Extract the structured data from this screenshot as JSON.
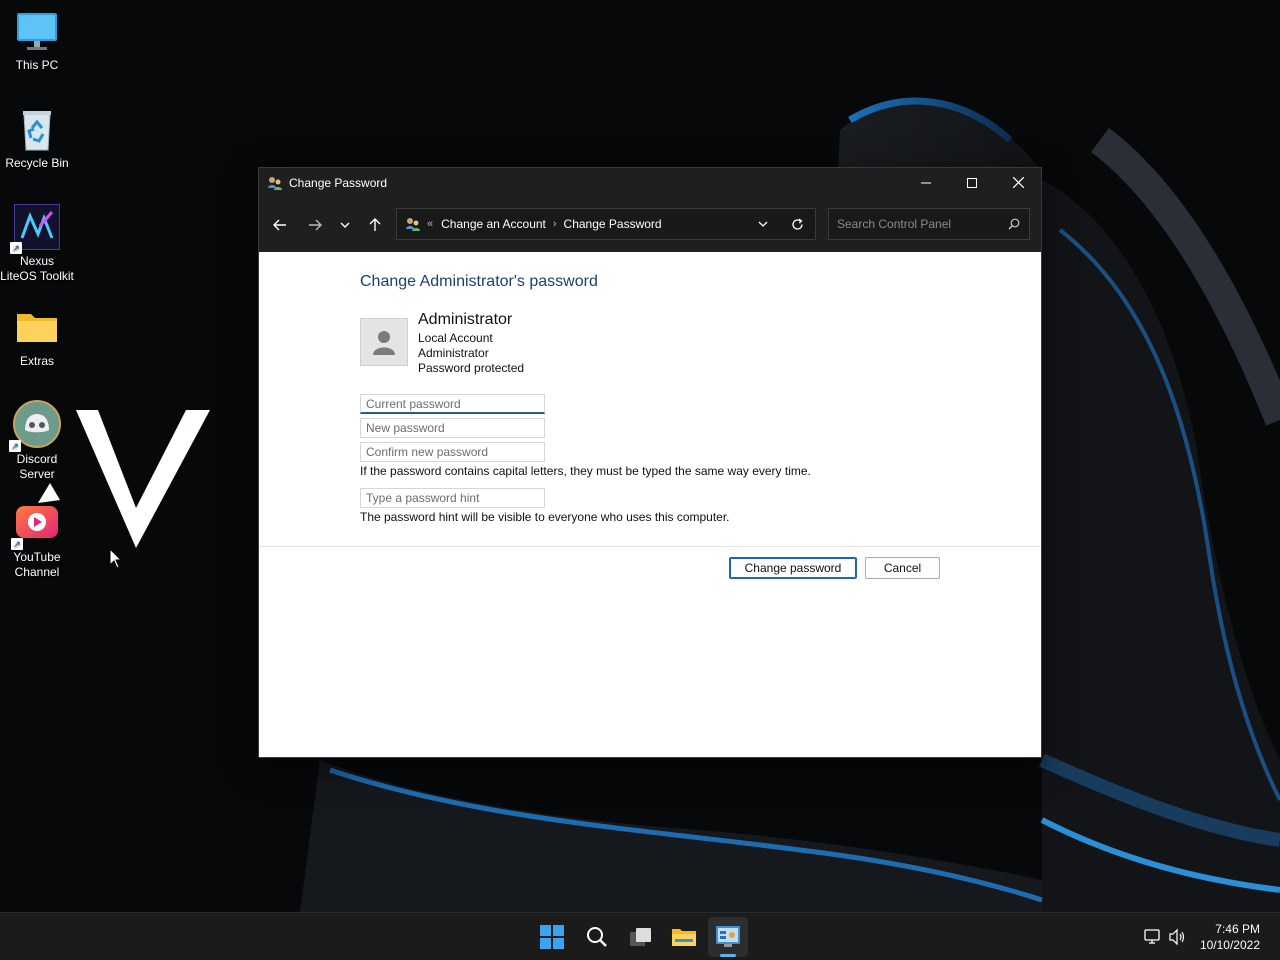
{
  "desktop": {
    "icons": [
      {
        "label": "This PC",
        "icon": "monitor-icon"
      },
      {
        "label": "Recycle Bin",
        "icon": "recycle-bin-icon"
      },
      {
        "label": "Nexus LiteOS Toolkit",
        "icon": "nexus-toolkit-icon"
      },
      {
        "label": "Extras",
        "icon": "folder-icon"
      },
      {
        "label": "Discord Server",
        "icon": "discord-icon"
      },
      {
        "label": "YouTube Channel",
        "icon": "youtube-icon"
      }
    ]
  },
  "window": {
    "title": "Change Password",
    "breadcrumb": {
      "overflow": "«",
      "items": [
        "Change an Account",
        "Change Password"
      ]
    },
    "search": {
      "placeholder": "Search Control Panel"
    },
    "content": {
      "heading": "Change Administrator's password",
      "account": {
        "name": "Administrator",
        "lines": [
          "Local Account",
          "Administrator",
          "Password protected"
        ]
      },
      "fields": {
        "current_placeholder": "Current password",
        "new_placeholder": "New password",
        "confirm_placeholder": "Confirm new password",
        "hint_placeholder": "Type a password hint"
      },
      "case_note": "If the password contains capital letters, they must be typed the same way every time.",
      "hint_note": "The password hint will be visible to everyone who uses this computer.",
      "buttons": {
        "change": "Change password",
        "cancel": "Cancel"
      }
    }
  },
  "taskbar": {
    "items": [
      "start-icon",
      "search-icon",
      "task-view-icon",
      "file-explorer-icon",
      "control-panel-icon"
    ],
    "clock": {
      "time": "7:46 PM",
      "date": "10/10/2022"
    }
  },
  "colors": {
    "accent": "#1a64c8",
    "heading": "#1e3e73",
    "wallpaper_highlight": "#2a8fd6"
  }
}
